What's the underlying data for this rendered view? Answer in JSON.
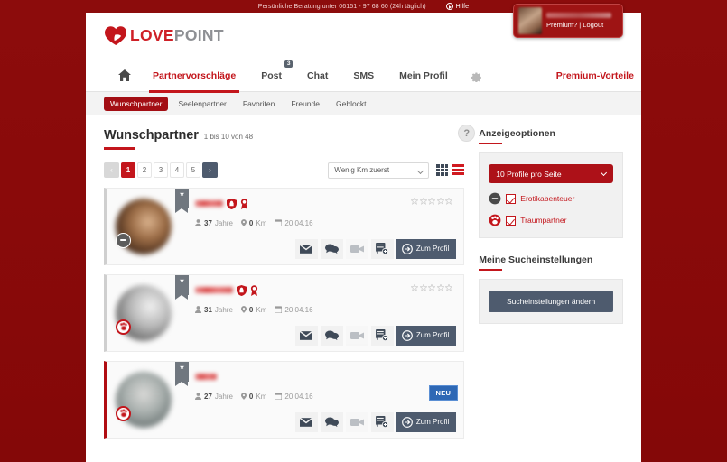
{
  "topbar": {
    "phone_text": "Persönliche Beratung unter 06151 - 97 68 60 (24h täglich)",
    "help_label": "Hilfe",
    "help_icon": "play-circle-icon"
  },
  "user_badge": {
    "username_masked": "",
    "links": "Premium? | Logout",
    "avatar_icon": "user-avatar"
  },
  "logo": {
    "part1": "LOVE",
    "part2": "POINT",
    "icon": "heart-icon"
  },
  "mainnav": {
    "home_icon": "home-icon",
    "gear_icon": "gear-icon",
    "items": [
      {
        "label": "Partnervorschläge",
        "active": true
      },
      {
        "label": "Post",
        "badge": "3"
      },
      {
        "label": "Chat"
      },
      {
        "label": "SMS"
      },
      {
        "label": "Mein Profil"
      }
    ],
    "premium_label": "Premium-Vorteile"
  },
  "subnav": {
    "items": [
      {
        "label": "Wunschpartner",
        "active": true
      },
      {
        "label": "Seelenpartner"
      },
      {
        "label": "Favoriten"
      },
      {
        "label": "Freunde"
      },
      {
        "label": "Geblockt"
      }
    ]
  },
  "header": {
    "title": "Wunschpartner",
    "range_prefix": "1 bis 10",
    "range_suffix": "von 48",
    "count_text": "1 bis 10 von 48",
    "help_button": "?"
  },
  "toolbar": {
    "prev": "‹",
    "next": "›",
    "pages": [
      "1",
      "2",
      "3",
      "4",
      "5"
    ],
    "active_page": "1",
    "sort_value": "Wenig Km zuerst",
    "grid_icon": "grid-view-icon",
    "list_icon": "list-view-icon"
  },
  "cards": [
    {
      "username_masked": "",
      "age": "37",
      "age_unit": "Jahre",
      "distance": "0",
      "distance_unit": "Km",
      "date": "20.04.16",
      "rating": 0,
      "verified_shield": true,
      "verified_award": true,
      "is_new": false,
      "chip": "gray",
      "avatar": "a1",
      "bookmark_icon": "bookmark-star-icon",
      "actions": {
        "mail": "mail-icon",
        "chat": "chat-icon",
        "video": "video-icon",
        "note": "note-add-icon",
        "profile_label": "Zum Profil"
      }
    },
    {
      "username_masked": "",
      "age": "31",
      "age_unit": "Jahre",
      "distance": "0",
      "distance_unit": "Km",
      "date": "20.04.16",
      "rating": 0,
      "verified_shield": true,
      "verified_award": true,
      "is_new": false,
      "chip": "red",
      "avatar": "a2",
      "bookmark_icon": "bookmark-star-icon",
      "actions": {
        "mail": "mail-icon",
        "chat": "chat-icon",
        "video": "video-icon",
        "note": "note-add-icon",
        "profile_label": "Zum Profil"
      }
    },
    {
      "username_masked": "",
      "age": "27",
      "age_unit": "Jahre",
      "distance": "0",
      "distance_unit": "Km",
      "date": "20.04.16",
      "rating": 0,
      "verified_shield": false,
      "verified_award": false,
      "is_new": true,
      "new_label": "NEU",
      "chip": "red",
      "avatar": "a3",
      "bookmark_icon": "bookmark-star-icon",
      "actions": {
        "mail": "mail-icon",
        "chat": "chat-icon",
        "video": "video-icon",
        "note": "note-add-icon",
        "profile_label": "Zum Profil"
      }
    }
  ],
  "sidebar": {
    "display_options": {
      "heading": "Anzeigeoptionen",
      "per_page_value": "10 Profile pro Seite",
      "checkboxes": [
        {
          "label": "Erotikabenteuer",
          "checked": true,
          "icon": "minus-circle-icon"
        },
        {
          "label": "Traumpartner",
          "checked": true,
          "icon": "paw-circle-icon"
        }
      ]
    },
    "search_settings": {
      "heading": "Meine Sucheinstellungen",
      "button_label": "Sucheinstellungen ändern"
    }
  },
  "colors": {
    "brand_red": "#c3161c",
    "dark_red": "#a30e14",
    "page_bg": "#8a0a0a",
    "navy": "#4e5b6e",
    "new_blue": "#2e68b5"
  }
}
